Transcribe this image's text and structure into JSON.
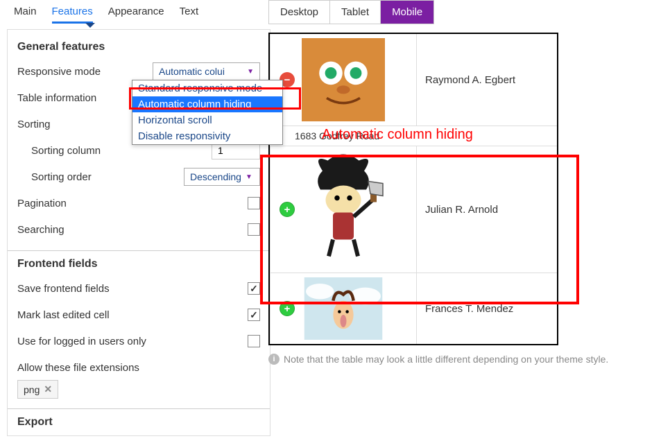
{
  "tabs": {
    "main": "Main",
    "features": "Features",
    "appearance": "Appearance",
    "text": "Text"
  },
  "sections": {
    "general": "General features",
    "frontend": "Frontend fields",
    "export": "Export"
  },
  "labels": {
    "responsive_mode": "Responsive mode",
    "table_information": "Table information",
    "sorting": "Sorting",
    "sorting_column": "Sorting column",
    "sorting_order": "Sorting order",
    "pagination": "Pagination",
    "searching": "Searching",
    "save_frontend": "Save frontend fields",
    "mark_last": "Mark last edited cell",
    "logged_only": "Use for logged in users only",
    "allow_ext": "Allow these file extensions"
  },
  "values": {
    "responsive_mode_selected": "Automatic colui",
    "sorting_column": "1",
    "sorting_order": "Descending",
    "file_ext_tag": "png"
  },
  "dropdown": {
    "opt1": "Standard responsive mode",
    "opt2": "Automatic column hiding",
    "opt3": "Horizontal scroll",
    "opt4": "Disable responsivity"
  },
  "device_tabs": {
    "desktop": "Desktop",
    "tablet": "Tablet",
    "mobile": "Mobile"
  },
  "preview_rows": {
    "name1": "Raymond A. Egbert",
    "address1": "1683 Godfrey Road",
    "name2": "Julian R. Arnold",
    "name3": "Frances T. Mendez"
  },
  "preview_annotation": "Automatic column hiding",
  "note_text": "Note that the table may look a little different depending on your theme style."
}
